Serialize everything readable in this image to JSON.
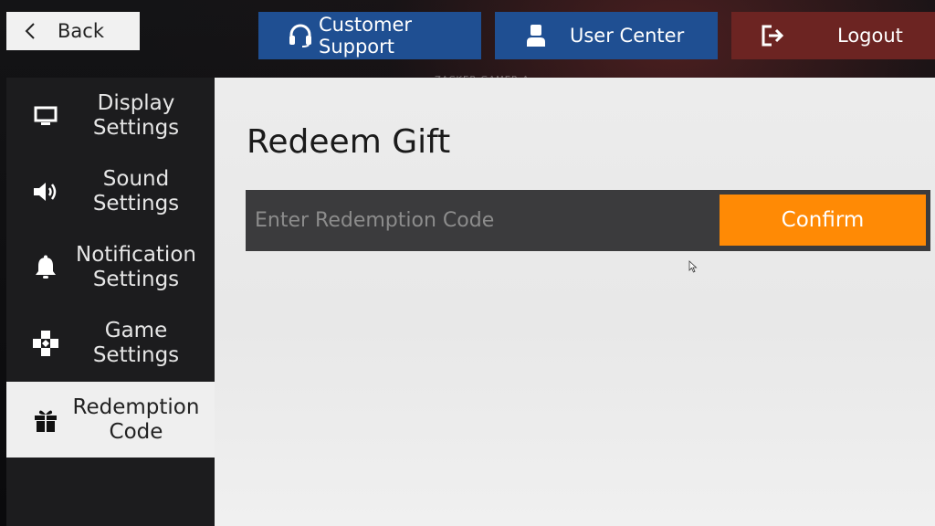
{
  "header": {
    "back_label": "Back",
    "support_label": "Customer Support",
    "user_center_label": "User Center",
    "logout_label": "Logout",
    "watermark": "ZACKER GAMER A"
  },
  "sidebar": {
    "items": [
      {
        "line1": "Display",
        "line2": "Settings",
        "icon": "monitor-icon"
      },
      {
        "line1": "Sound",
        "line2": "Settings",
        "icon": "speaker-icon"
      },
      {
        "line1": "Notification",
        "line2": "Settings",
        "icon": "bell-icon"
      },
      {
        "line1": "Game",
        "line2": "Settings",
        "icon": "gamepad-icon"
      },
      {
        "line1": "Redemption",
        "line2": "Code",
        "icon": "gift-icon",
        "active": true
      }
    ]
  },
  "main": {
    "title": "Redeem Gift",
    "code_input": {
      "value": "",
      "placeholder": "Enter Redemption Code"
    },
    "confirm_label": "Confirm"
  },
  "colors": {
    "blue_button": "#1f4f92",
    "logout_button": "#6c2422",
    "confirm_button": "#ff8a05",
    "sidebar_bg": "#1c1c1e",
    "active_item_bg": "#efefef"
  }
}
